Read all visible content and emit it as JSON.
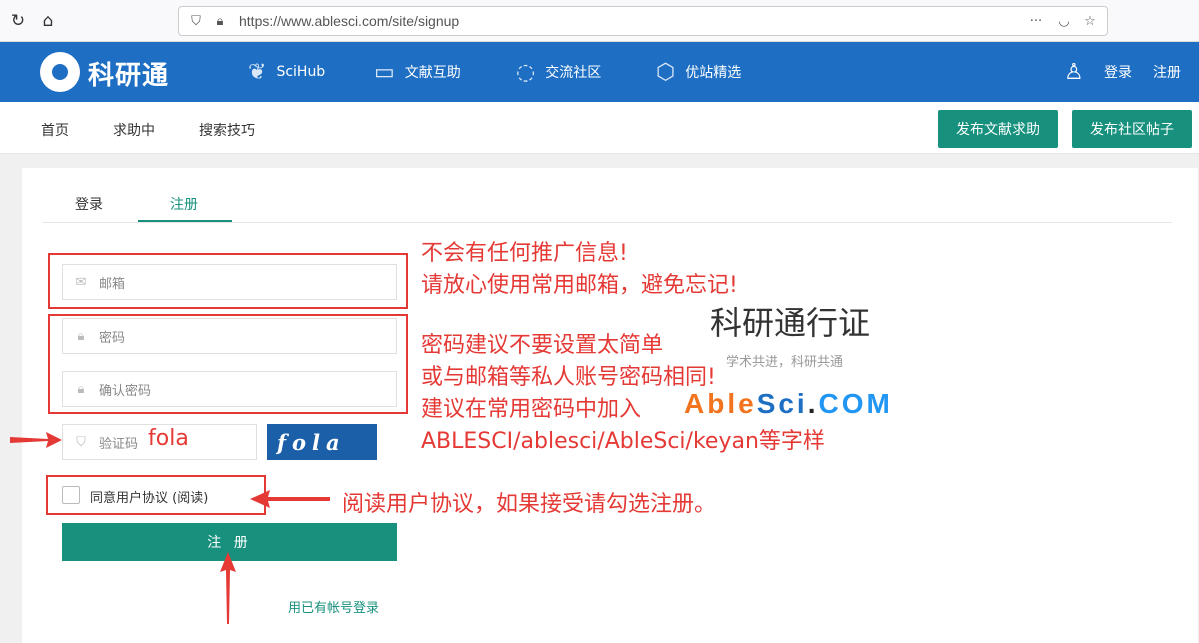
{
  "browser": {
    "url": "https://www.ablesci.com/site/signup",
    "reload_icon": "reload-icon",
    "home_icon": "home-icon"
  },
  "header": {
    "logo_text": "科研通",
    "nav": [
      {
        "label": "SciHub",
        "icon": "bird-icon"
      },
      {
        "label": "文献互助",
        "icon": "book-icon"
      },
      {
        "label": "交流社区",
        "icon": "chat-icon"
      },
      {
        "label": "优站精选",
        "icon": "cube-icon"
      }
    ],
    "login": "登录",
    "register": "注册"
  },
  "subnav": {
    "items": [
      "首页",
      "求助中",
      "搜索技巧"
    ],
    "btn_post_request": "发布文献求助",
    "btn_post_community": "发布社区帖子"
  },
  "form": {
    "tab_login": "登录",
    "tab_register": "注册",
    "email_placeholder": "邮箱",
    "password_placeholder": "密码",
    "confirm_placeholder": "确认密码",
    "captcha_placeholder": "验证码",
    "captcha_typed": "fola",
    "captcha_image_text": "fola",
    "agree_label": "同意用户协议 (阅读)",
    "submit": "注 册",
    "login_link": "用已有帐号登录"
  },
  "brand": {
    "title": "科研通行证",
    "subtitle": "学术共进，科研共通"
  },
  "annotations": {
    "email_line1": "不会有任何推广信息!",
    "email_line2": "请放心使用常用邮箱，避免忘记!",
    "pwd_line1": "密码建议不要设置太简单",
    "pwd_line2": "或与邮箱等私人账号密码相同!",
    "pwd_line3": "建议在常用密码中加入",
    "pwd_line4": "ABLESCI/ablesci/AbleSci/keyan等字样",
    "agree_note": "阅读用户协议，如果接受请勾选注册。",
    "ablesci_parts": [
      "Able",
      "Sci",
      ".",
      "COM"
    ]
  },
  "colors": {
    "header_blue": "#1e6fc4",
    "green": "#17917d",
    "annot_red": "#e53935",
    "able_orange": "#f2741f",
    "sci_blue": "#1e6fc4",
    "com_lightblue": "#2196f3"
  }
}
